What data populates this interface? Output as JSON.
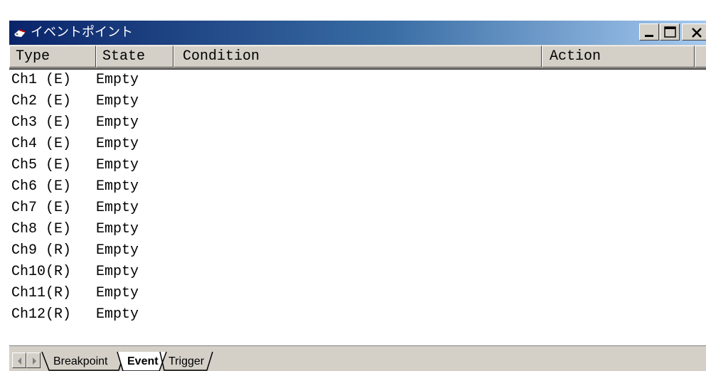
{
  "window": {
    "title": "イベントポイント",
    "icon": "event-app-icon",
    "controls": {
      "minimize": "minimize-icon",
      "maximize": "maximize-icon",
      "close": "close-icon"
    }
  },
  "columns": {
    "type": "Type",
    "state": "State",
    "condition": "Condition",
    "action": "Action"
  },
  "rows": [
    {
      "type": "Ch1 (E)",
      "state": "Empty"
    },
    {
      "type": "Ch2 (E)",
      "state": "Empty"
    },
    {
      "type": "Ch3 (E)",
      "state": "Empty"
    },
    {
      "type": "Ch4 (E)",
      "state": "Empty"
    },
    {
      "type": "Ch5 (E)",
      "state": "Empty"
    },
    {
      "type": "Ch6 (E)",
      "state": "Empty"
    },
    {
      "type": "Ch7 (E)",
      "state": "Empty"
    },
    {
      "type": "Ch8 (E)",
      "state": "Empty"
    },
    {
      "type": "Ch9 (R)",
      "state": "Empty"
    },
    {
      "type": "Ch10(R)",
      "state": "Empty"
    },
    {
      "type": "Ch11(R)",
      "state": "Empty"
    },
    {
      "type": "Ch12(R)",
      "state": "Empty"
    }
  ],
  "tabs": [
    {
      "label": "Breakpoint",
      "active": false
    },
    {
      "label": "Event",
      "active": true
    },
    {
      "label": "Trigger",
      "active": false
    }
  ],
  "colors": {
    "title_gradient_start": "#0a246a",
    "title_gradient_end": "#a6caf0",
    "chrome": "#d4d0c8"
  }
}
